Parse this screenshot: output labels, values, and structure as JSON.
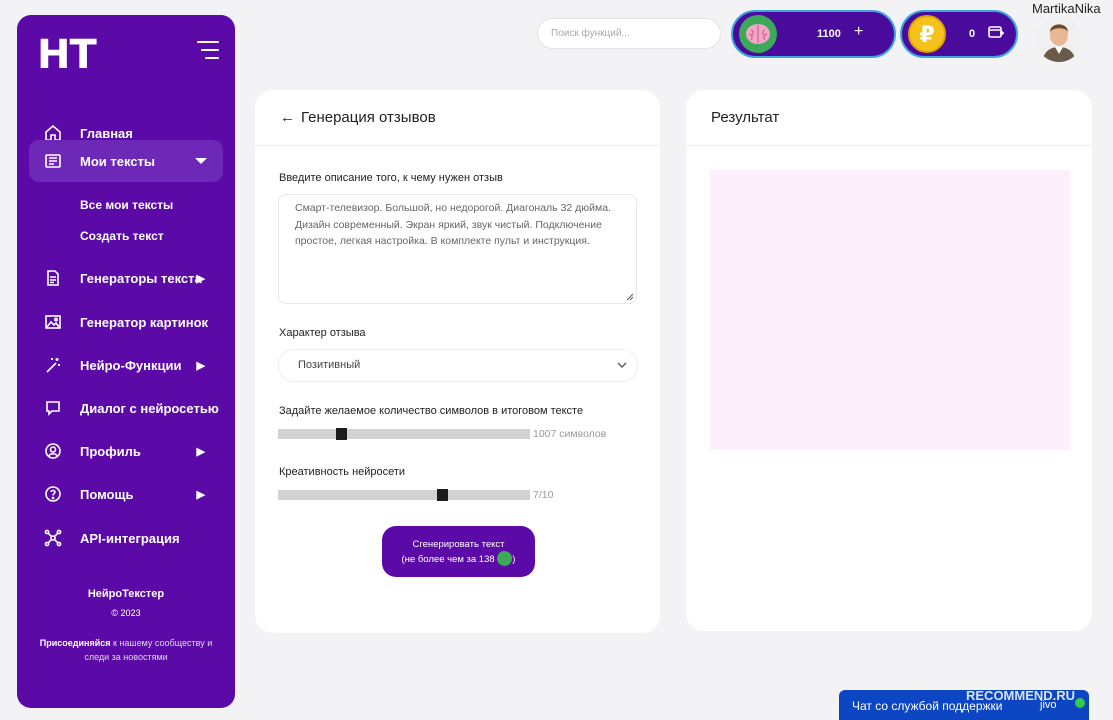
{
  "sidebar": {
    "logo": "НТ",
    "items": [
      {
        "label": "Главная",
        "icon": "home-icon"
      },
      {
        "label": "Мои тексты",
        "icon": "book-icon"
      },
      {
        "label": "Генераторы текста",
        "icon": "document-icon"
      },
      {
        "label": "Генератор картинок",
        "icon": "image-icon"
      },
      {
        "label": "Нейро-Функции",
        "icon": "magic-wand-icon"
      },
      {
        "label": "Диалог с нейросетью",
        "icon": "chat-icon"
      },
      {
        "label": "Профиль",
        "icon": "profile-icon"
      },
      {
        "label": "Помощь",
        "icon": "help-icon"
      },
      {
        "label": "API-интеграция",
        "icon": "api-icon"
      }
    ],
    "subitems": [
      "Все мои тексты",
      "Создать текст"
    ],
    "footer": {
      "brand": "НейроТекстер",
      "copyright": "© 2023",
      "join_bold": "Присоединяйся",
      "join_rest": " к нашему сообществу и следи за новостями"
    }
  },
  "header": {
    "search_placeholder": "Поиск функций...",
    "tokens": {
      "amount": "1100",
      "action": "+"
    },
    "rubles": {
      "amount": "0"
    },
    "username": "MartikaNika"
  },
  "form": {
    "title": "Генерация отзывов",
    "description_label": "Введите описание того, к чему нужен отзыв",
    "description_value": "Смарт-телевизор. Большой, но недорогой. Диагональ 32 дюйма. Дизайн современный. Экран яркий, звук чистый. Подключение простое, легкая настройка. В комплекте пульт и инструкция.",
    "character_label": "Характер отзыва",
    "character_value": "Позитивный",
    "length_label": "Задайте желаемое количество символов в итоговом тексте",
    "length_value": "1007 символов",
    "length_fraction": 0.24,
    "creativity_label": "Креативность нейросети",
    "creativity_value": "7/10",
    "creativity_fraction": 0.66,
    "button_line1": "Сгенерировать текст",
    "button_line2_pre": "(не более чем за 138",
    "button_line2_post": ")"
  },
  "result": {
    "title": "Результат"
  },
  "chat": {
    "label": "Чат со службой поддержки",
    "brand": "jivo"
  },
  "watermark": "RECOMMEND.RU",
  "colors": {
    "primary": "#5b0aa8",
    "wallet_border": "#3ea6dd",
    "result_bg": "#fdf0fc",
    "chat_bg": "#0c46c2"
  }
}
